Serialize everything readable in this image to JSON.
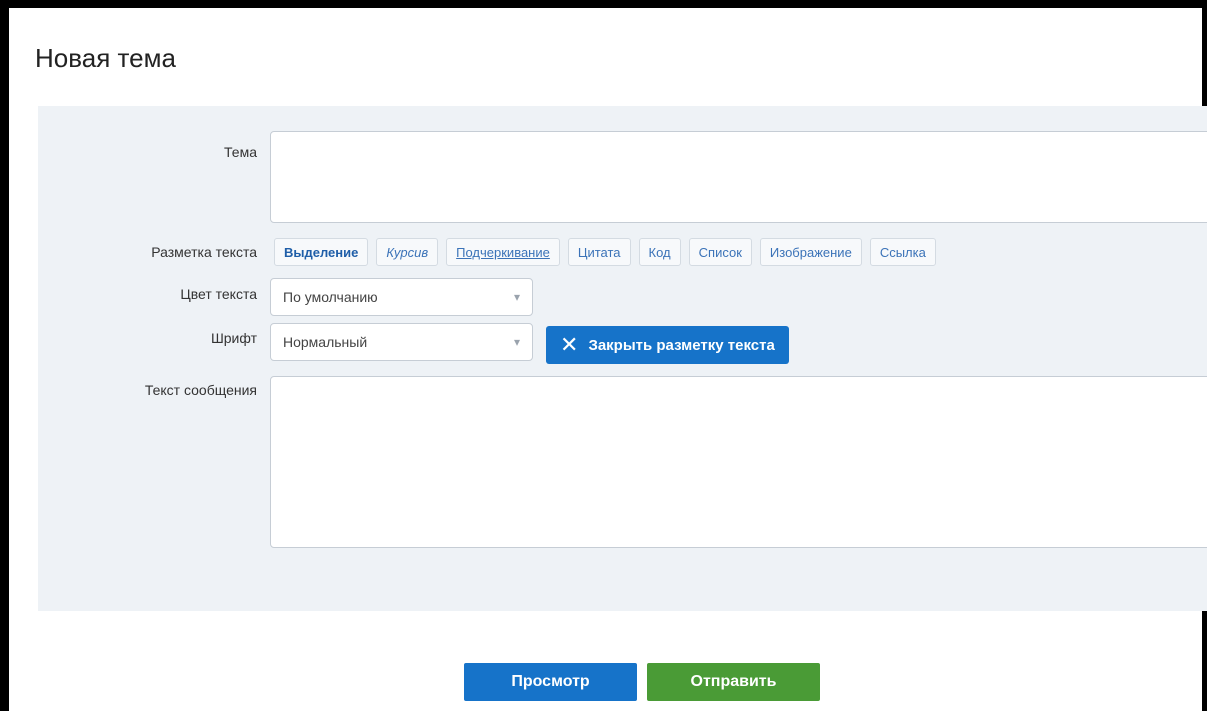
{
  "page": {
    "title": "Новая тема"
  },
  "form": {
    "subject_label": "Тема",
    "subject_value": "",
    "markup_label": "Разметка текста",
    "markup_buttons": [
      "Выделение",
      "Курсив",
      "Подчеркивание",
      "Цитата",
      "Код",
      "Список",
      "Изображение",
      "Ссылка"
    ],
    "color_label": "Цвет текста",
    "color_value": "По умолчанию",
    "font_label": "Шрифт",
    "font_value": "Нормальный",
    "close_markup_label": "Закрыть разметку текста",
    "message_label": "Текст сообщения",
    "message_value": ""
  },
  "actions": {
    "preview_label": "Просмотр",
    "submit_label": "Отправить"
  },
  "icons": {
    "close": "close-icon",
    "dropdown": "chevron-down-icon"
  },
  "colors": {
    "primary": "#1673c9",
    "success": "#4a9b36",
    "panel": "#eef2f6"
  }
}
